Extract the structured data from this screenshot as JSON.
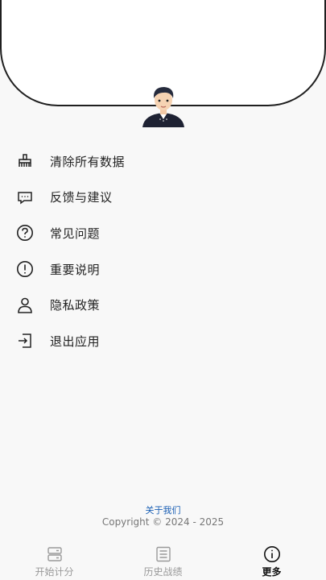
{
  "menu": {
    "items": [
      {
        "label": "清除所有数据",
        "icon": "broom-icon"
      },
      {
        "label": "反馈与建议",
        "icon": "feedback-icon"
      },
      {
        "label": "常见问题",
        "icon": "question-icon"
      },
      {
        "label": "重要说明",
        "icon": "exclamation-icon"
      },
      {
        "label": "隐私政策",
        "icon": "person-icon"
      },
      {
        "label": "退出应用",
        "icon": "exit-icon"
      }
    ]
  },
  "footer": {
    "about": "关于我们",
    "copyright": "Copyright © 2024 - 2025"
  },
  "tabbar": {
    "tabs": [
      {
        "label": "开始计分",
        "icon": "scoreboard-icon",
        "active": false
      },
      {
        "label": "历史战绩",
        "icon": "list-icon",
        "active": false
      },
      {
        "label": "更多",
        "icon": "info-icon",
        "active": true
      }
    ]
  },
  "colors": {
    "accent_link": "#1a5fb4",
    "active_tab": "#111111",
    "inactive_tab": "#999999"
  }
}
